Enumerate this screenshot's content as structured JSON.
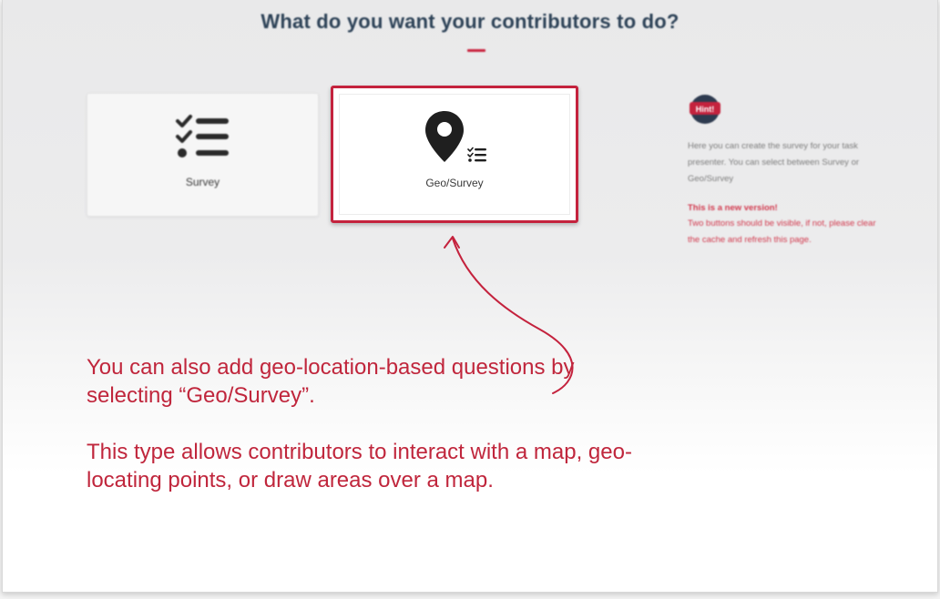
{
  "heading": "What do you want your contributors to do?",
  "options": {
    "survey_label": "Survey",
    "geo_survey_label": "Geo/Survey"
  },
  "hint": {
    "badge": "Hint!",
    "text": "Here you can create the survey for your task presenter. You can select between Survey or Geo/Survey",
    "note_title": "This is a new version!",
    "note": "Two buttons should be visible, if not, please clear the cache and refresh this page."
  },
  "annotation": {
    "line1": "You can also add geo-location-based questions by selecting “Geo/Survey”.",
    "line2": "This type allows contributors to interact with a map, geo-locating points, or draw areas over a map."
  },
  "colors": {
    "accent_red": "#c4223d",
    "heading_blue": "#2d4257"
  }
}
